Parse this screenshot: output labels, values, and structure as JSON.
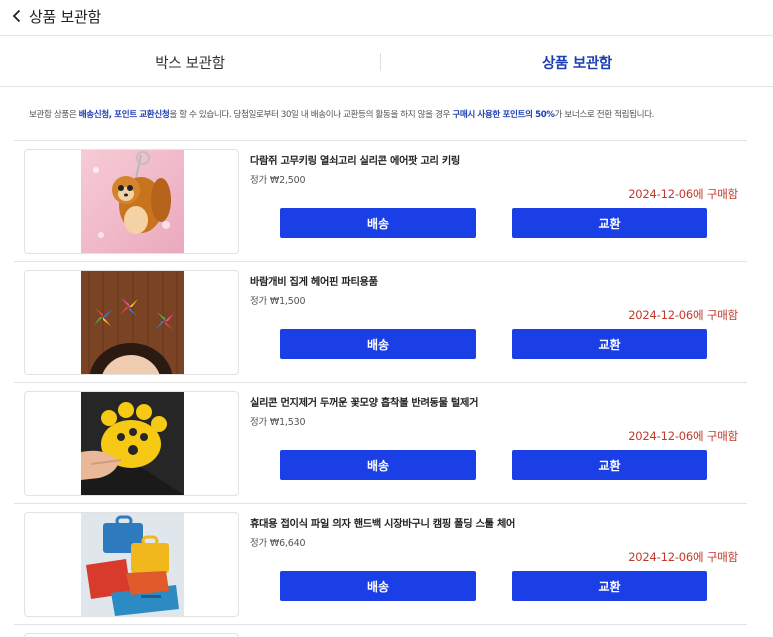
{
  "header": {
    "title": "상품 보관함",
    "back_icon": "chevron-left-icon"
  },
  "tabs": [
    {
      "label": "박스 보관함",
      "active": false
    },
    {
      "label": "상품 보관함",
      "active": true
    }
  ],
  "notice": {
    "t1": "보관함 상품은 ",
    "h1": "배송신청, 포인트 교환신청",
    "t2": "을 할 수 있습니다. 당첨일로부터 30일 내 배송이나 교환등의 활동을 하지 않을 경우 ",
    "h2": "구매시 사용한 포인트의 50%",
    "t3": "가 보너스로 전환 적립됩니다."
  },
  "items": [
    {
      "name": "다람쥐 고무키링 열쇠고리 실리콘 에어팟 고리 키링",
      "price": "정가 ₩2,500",
      "date": "2024-12-06에 구매함",
      "ship_label": "배송",
      "exchange_label": "교환",
      "image": "squirrel-keyring-image"
    },
    {
      "name": "바람개비 집게 헤어핀 파티용품",
      "price": "정가 ₩1,500",
      "date": "2024-12-06에 구매함",
      "ship_label": "배송",
      "exchange_label": "교환",
      "image": "pinwheel-hairpin-image"
    },
    {
      "name": "실리콘 먼지제거 두꺼운 꽃모양 흡착볼 반려동물 털제거",
      "price": "정가 ₩1,530",
      "date": "2024-12-06에 구매함",
      "ship_label": "배송",
      "exchange_label": "교환",
      "image": "paw-lint-remover-image"
    },
    {
      "name": "휴대용 접이식 파일 의자 핸드백 시장바구니 캠핑 폴딩 스툴 체어",
      "price": "정가 ₩6,640",
      "date": "2024-12-06에 구매함",
      "ship_label": "배송",
      "exchange_label": "교환",
      "image": "folding-stool-image"
    }
  ],
  "colors": {
    "accent": "#1a3fe6",
    "tab_active": "#1d3fb5",
    "date": "#c0392b"
  }
}
